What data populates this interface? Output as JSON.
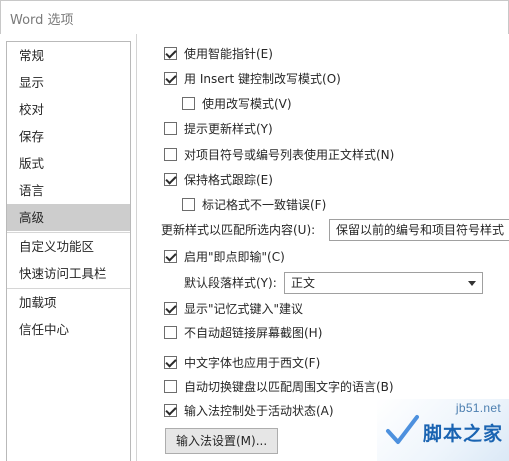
{
  "window": {
    "title": "Word 选项"
  },
  "sidebar": {
    "items": [
      {
        "label": "常规"
      },
      {
        "label": "显示"
      },
      {
        "label": "校对"
      },
      {
        "label": "保存"
      },
      {
        "label": "版式"
      },
      {
        "label": "语言"
      },
      {
        "label": "高级",
        "selected": true
      },
      {
        "label": "自定义功能区"
      },
      {
        "label": "快速访问工具栏"
      },
      {
        "label": "加载项"
      },
      {
        "label": "信任中心"
      }
    ]
  },
  "options": {
    "smart_cursor": {
      "label": "使用智能指针(E)",
      "checked": true
    },
    "insert_key": {
      "label": "用 Insert 键控制改写模式(O)",
      "checked": true
    },
    "overtype": {
      "label": "使用改写模式(V)",
      "checked": false
    },
    "prompt_update_style": {
      "label": "提示更新样式(Y)",
      "checked": false
    },
    "normal_style_lists": {
      "label": "对项目符号或编号列表使用正文样式(N)",
      "checked": false
    },
    "keep_track_formatting": {
      "label": "保持格式跟踪(E)",
      "checked": true
    },
    "mark_inconsistencies": {
      "label": "标记格式不一致错误(F)",
      "checked": false
    },
    "update_style_label": "更新样式以匹配所选内容(U):",
    "update_style_value": "保留以前的编号和项目符号样式",
    "click_and_type": {
      "label": "启用\"即点即输\"(C)",
      "checked": true
    },
    "default_para_label": "默认段落样式(Y):",
    "default_para_value": "正文",
    "autocomplete": {
      "label": "显示\"记忆式键入\"建议",
      "checked": true
    },
    "no_hyperlink_screenshot": {
      "label": "不自动超链接屏幕截图(H)",
      "checked": false
    },
    "east_asian_font_western": {
      "label": "中文字体也应用于西文(F)",
      "checked": true
    },
    "auto_switch_keyboard": {
      "label": "自动切换键盘以匹配周围文字的语言(B)",
      "checked": false
    },
    "ime_control": {
      "label": "输入法控制处于活动状态(A)",
      "checked": true
    },
    "ime_settings_button": "输入法设置(M)..."
  },
  "watermark": {
    "url": "jb51.net",
    "name": "脚本之家"
  }
}
